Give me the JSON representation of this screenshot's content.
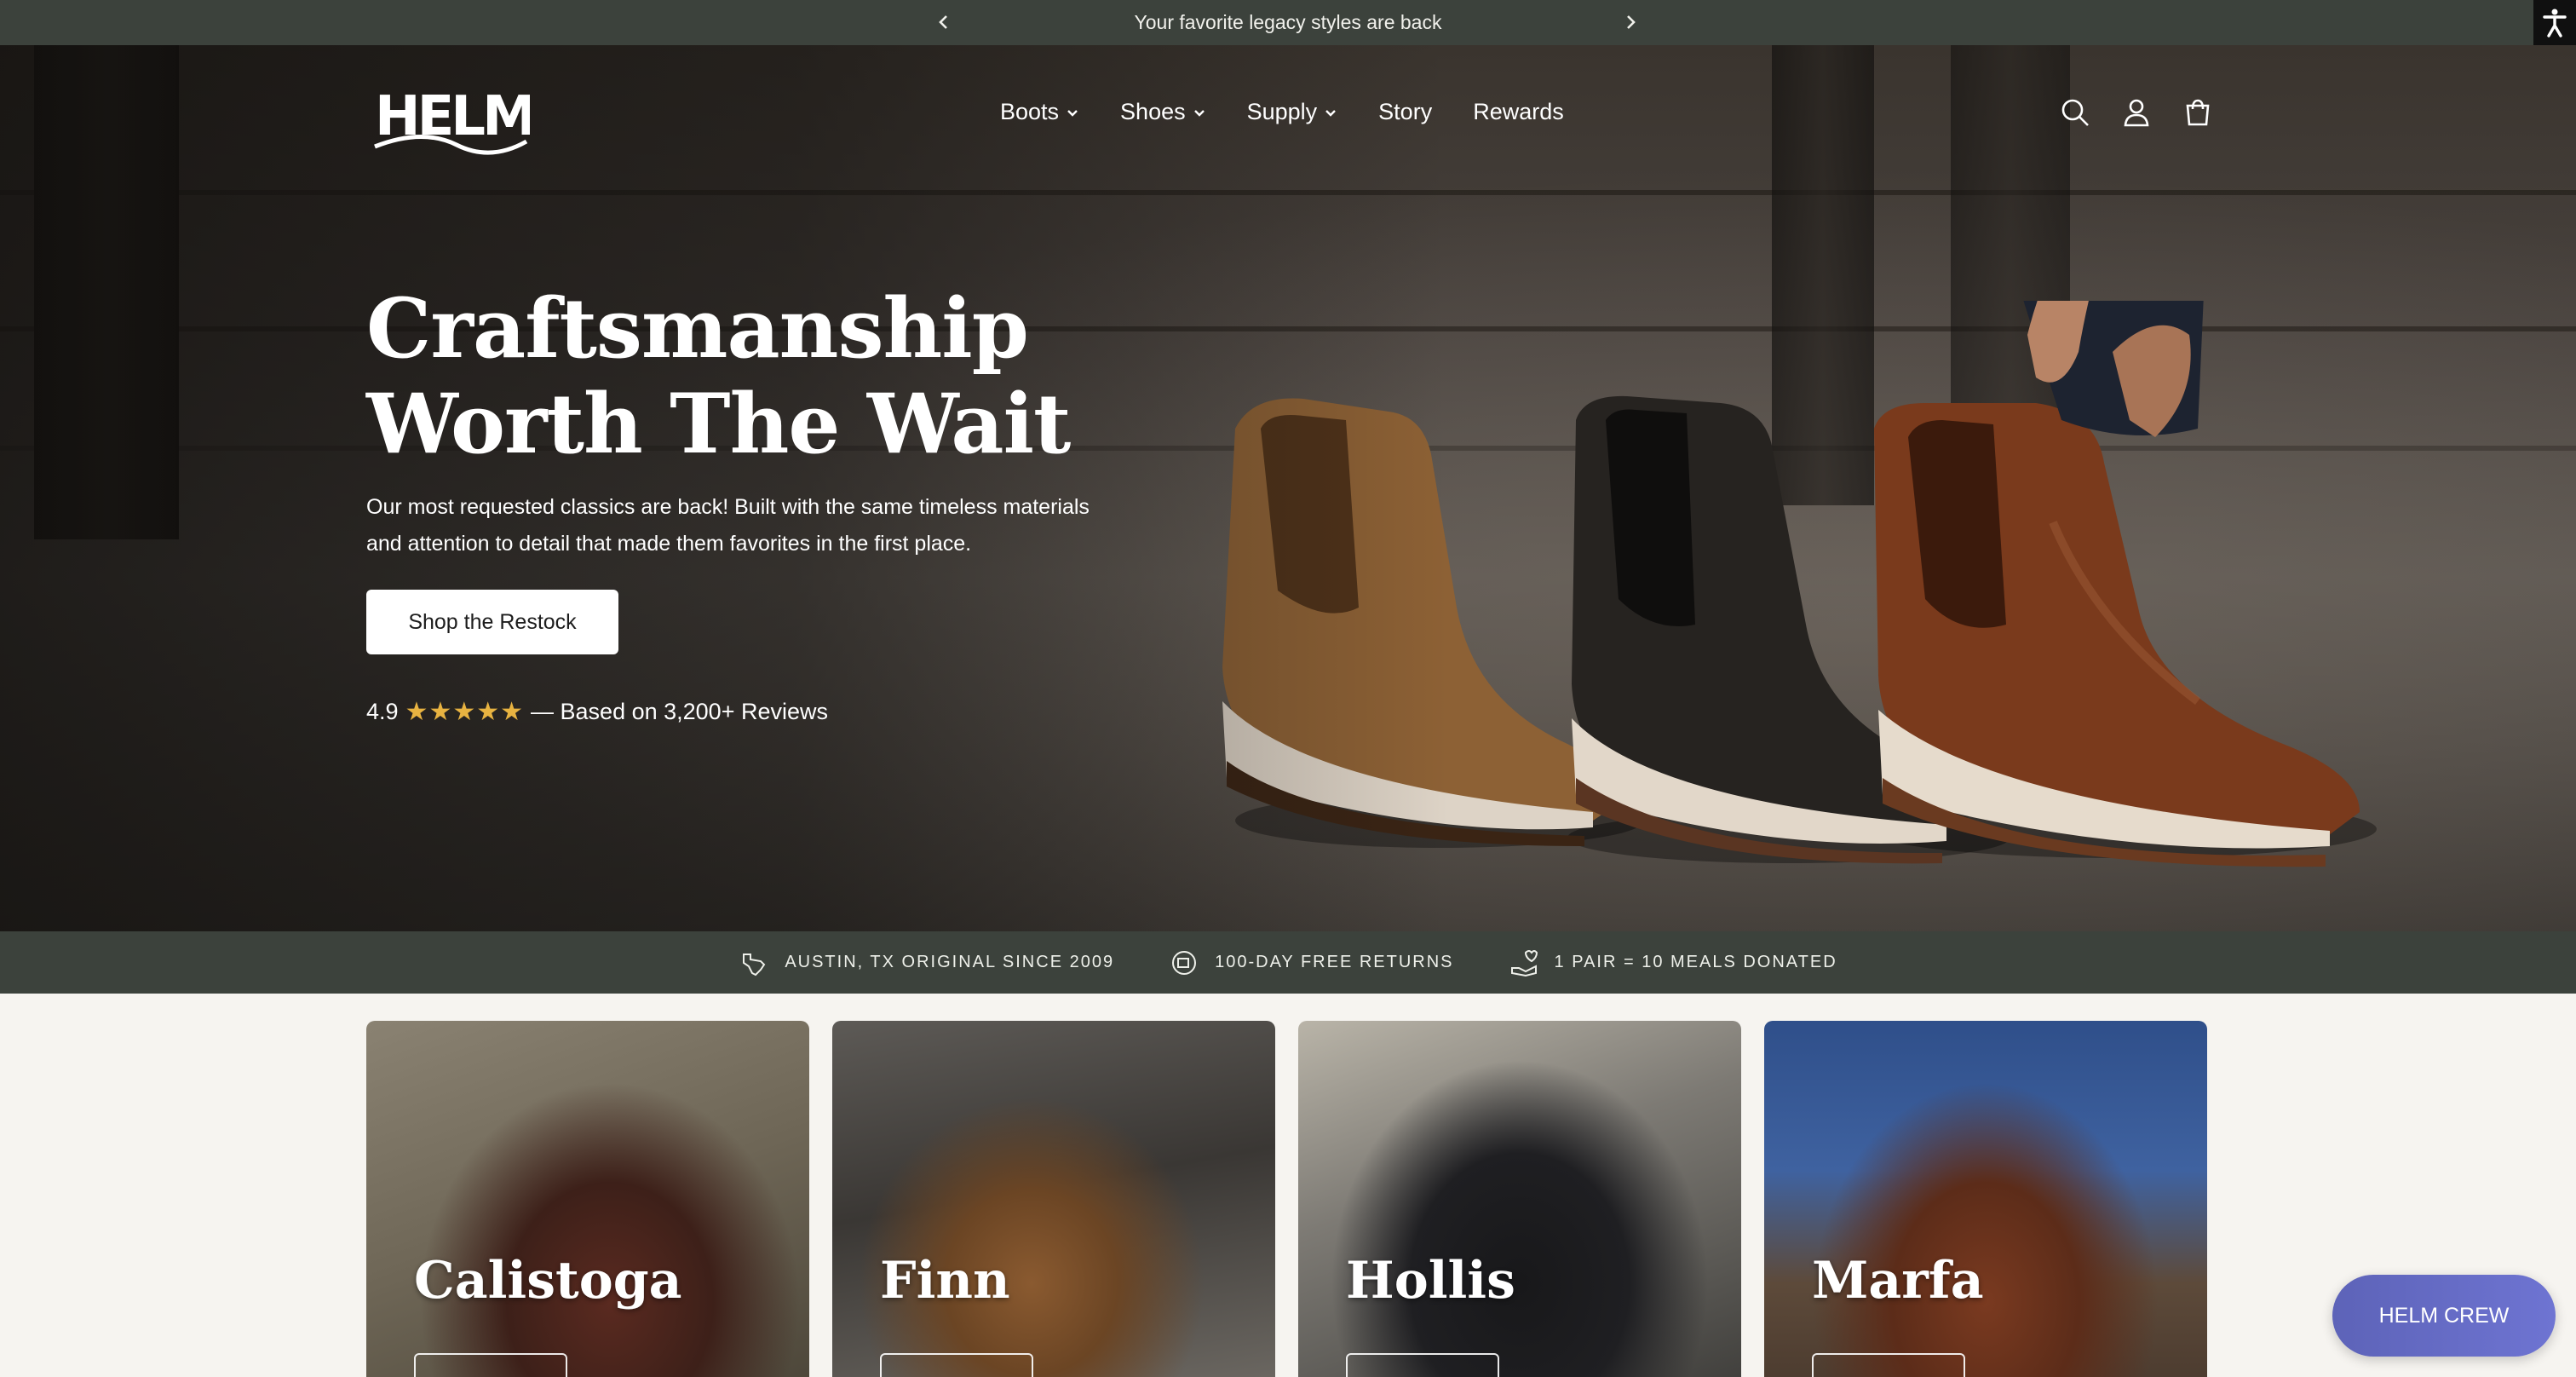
{
  "announcement": {
    "text": "Your favorite legacy styles are back",
    "prev_icon": "chevron-left-icon",
    "next_icon": "chevron-right-icon"
  },
  "accessibility": {
    "icon": "accessibility-icon"
  },
  "header": {
    "logo_text": "HELM",
    "nav": [
      {
        "label": "Boots",
        "has_dropdown": true
      },
      {
        "label": "Shoes",
        "has_dropdown": true
      },
      {
        "label": "Supply",
        "has_dropdown": true
      },
      {
        "label": "Story",
        "has_dropdown": false
      },
      {
        "label": "Rewards",
        "has_dropdown": false
      }
    ],
    "icons": [
      "search-icon",
      "account-icon",
      "cart-icon"
    ]
  },
  "hero": {
    "title_line1": "Craftsmanship",
    "title_line2": "Worth The Wait",
    "subtitle_line1": "Our most requested classics are back! Built with the same timeless materials",
    "subtitle_line2": "and attention to detail that made them favorites in the first place.",
    "cta_label": "Shop the Restock",
    "rating_value": "4.9",
    "rating_stars": 5,
    "rating_text": "— Based on 3,200+ Reviews"
  },
  "trust_bar": [
    {
      "icon": "texas-icon",
      "label": "AUSTIN, TX ORIGINAL SINCE 2009"
    },
    {
      "icon": "returns-icon",
      "label": "100-DAY FREE RETURNS"
    },
    {
      "icon": "donation-icon",
      "label": "1 PAIR = 10 MEALS DONATED"
    }
  ],
  "products": [
    {
      "name": "Calistoga"
    },
    {
      "name": "Finn"
    },
    {
      "name": "Hollis"
    },
    {
      "name": "Marfa"
    }
  ],
  "chat": {
    "label": "HELM CREW"
  },
  "colors": {
    "bar_bg": "#3c423c",
    "star": "#e8b341",
    "chat_bg": "#6369c4"
  }
}
